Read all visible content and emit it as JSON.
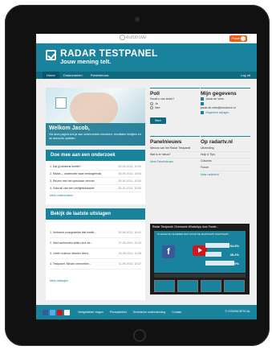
{
  "site": {
    "brand": "eurotrove",
    "cta_label": "Panel"
  },
  "header": {
    "logo_title": "RADAR TESTPANEL",
    "logo_subtitle": "Jouw mening telt."
  },
  "nav": {
    "items": [
      {
        "label": "Home"
      },
      {
        "label": "Onderzoeken"
      },
      {
        "label": "Panelnieuws"
      }
    ],
    "logout": "Log uit"
  },
  "hero": {
    "title": "Welkom Jacob,",
    "text": "Via deze pagina kun je aan onderzoeken meedoen, resultaten bekijken en de accounts updaten."
  },
  "research": {
    "heading": "Doe mee aan een onderzoek",
    "items": [
      {
        "title": "1. Dat jij winkens heefte?",
        "date": "09-09-2014, 10:54"
      },
      {
        "title": "2. Radar— onderzoek naar mediagebruik",
        "date": "09-09-2014, 10:54"
      },
      {
        "title": "3. Reizen met het openbaar vervoer",
        "date": "05-10-2014, 10:54"
      },
      {
        "title": "4. Gebruik van een veiligheidsbaner",
        "date": "08-10-2014, 10:54"
      }
    ],
    "more": "Meer onderzoeken"
  },
  "results": {
    "heading": "Bekijk de laatste uitslagen",
    "items": [
      {
        "title": "1. Verbeent voorgestelde titel heeftt...",
        "date": "09-06-2014, 10:41"
      },
      {
        "title": "2. Veel werkenden willen zich be...",
        "date": "27-06-2014, 11:03"
      },
      {
        "title": "3. Leven vrahuur stranen deen...",
        "date": "20-05-2014, 11:06"
      },
      {
        "title": "4. Testpanel: Minder internetten...",
        "date": "11-05-2014, 10:07"
      }
    ],
    "more": "Meer uitslagen"
  },
  "poll": {
    "heading": "Poll",
    "question": "Houdt u van lezen?",
    "options": [
      "Ja",
      "Nee"
    ],
    "button": "Stem"
  },
  "account": {
    "heading": "Mijn gegevens",
    "name": "Jacob de Vries",
    "email": "jacob.de.vries@eurotrove.nl",
    "edit": "Gegevens wijzigen"
  },
  "panelnews": {
    "heading": "Panelnieuws",
    "items": [
      "Nieuws van het Radar Testpanel",
      "Wat is er nieuw?"
    ],
    "more": "Meer Panelnieuws"
  },
  "radartv": {
    "heading": "Op radartv.nl",
    "items": [
      "Uitzending",
      "Hulp & Tips",
      "Columns",
      "Forum"
    ],
    "more": "Naar radartv.nl"
  },
  "video": {
    "title": "Radar Testpanel: Overname WhatsApp door Faceb...",
    "headline": "IS WAAR NU SLIMMER WAT KOOP DE WHATSAPP WHATSAPP",
    "stats": [
      {
        "label": "ZEER TROUW",
        "value": "54.8%"
      },
      {
        "label": "ZEER WEIN",
        "value": "39.2%"
      },
      {
        "label": "ZEER WEINIG",
        "value": "70%"
      }
    ]
  },
  "footer": {
    "links": [
      "Veelgestelde vragen",
      "Privacybeleid",
      "Technische ondersteuning",
      "Contact"
    ],
    "copyright": "© VISIONCRITICAL"
  },
  "colors": {
    "primary": "#19829c",
    "nav": "#126a80",
    "cta": "#f25c19"
  }
}
